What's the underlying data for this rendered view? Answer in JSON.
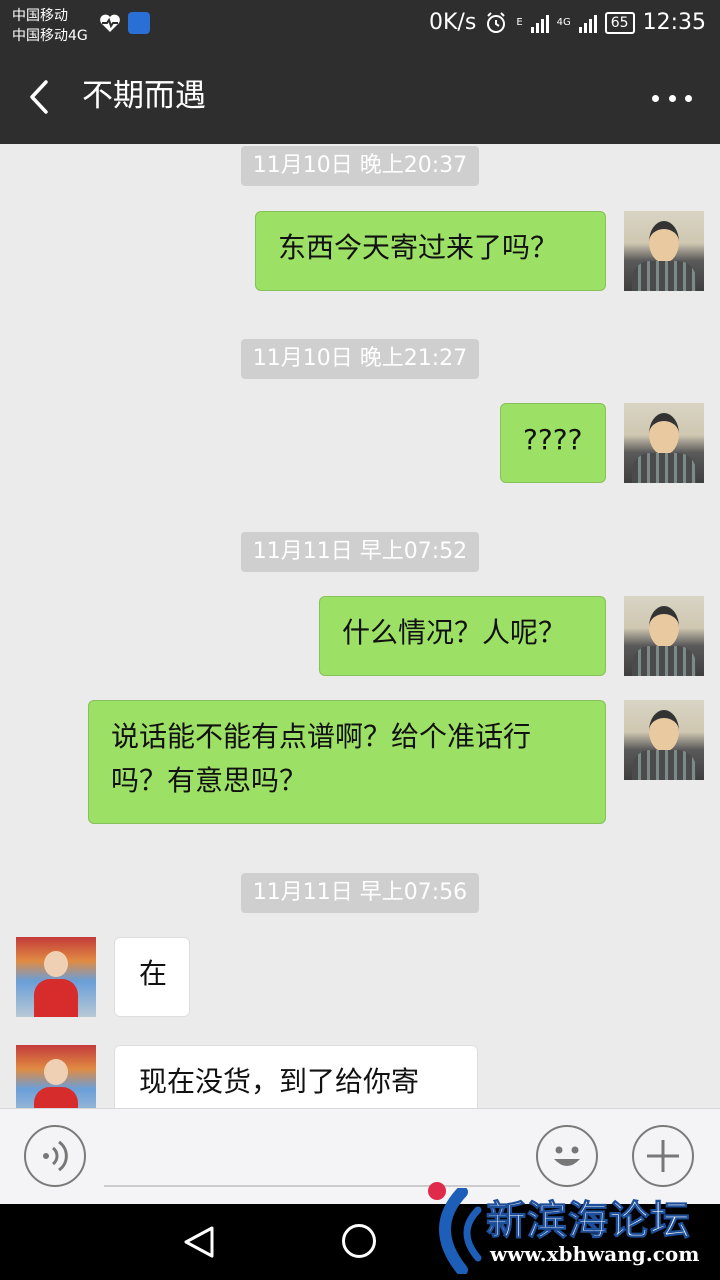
{
  "status_bar": {
    "carrier_1": "中国移动",
    "carrier_2": "中国移动4G",
    "speed": "0K/s",
    "network_1": "E",
    "network_2": "4G",
    "battery": "65",
    "time": "12:35"
  },
  "header": {
    "title": "不期而遇"
  },
  "messages": [
    {
      "type": "timestamp",
      "text": "11月10日 晚上20:37"
    },
    {
      "type": "sent",
      "text": "东西今天寄过来了吗？"
    },
    {
      "type": "timestamp",
      "text": "11月10日 晚上21:27"
    },
    {
      "type": "sent",
      "text": "????"
    },
    {
      "type": "timestamp",
      "text": "11月11日 早上07:52"
    },
    {
      "type": "sent",
      "text": "什么情况？人呢？"
    },
    {
      "type": "sent",
      "text": "说话能不能有点谱啊？给个准话行吗？有意思吗？"
    },
    {
      "type": "timestamp",
      "text": "11月11日 早上07:56"
    },
    {
      "type": "received",
      "text": "在"
    },
    {
      "type": "received",
      "text": "现在没货，到了给你寄"
    }
  ],
  "watermark": {
    "name": "新滨海论坛",
    "url": "www.xbhwang.com"
  },
  "colors": {
    "bar_background": "#2e2e2e",
    "sent_bubble": "#9de066",
    "received_bubble": "#ffffff",
    "chat_background": "#ebebeb"
  },
  "icons": [
    "back-arrow-icon",
    "more-icon",
    "voice-icon",
    "emoji-icon",
    "plus-icon",
    "nav-back-icon",
    "nav-home-icon"
  ]
}
